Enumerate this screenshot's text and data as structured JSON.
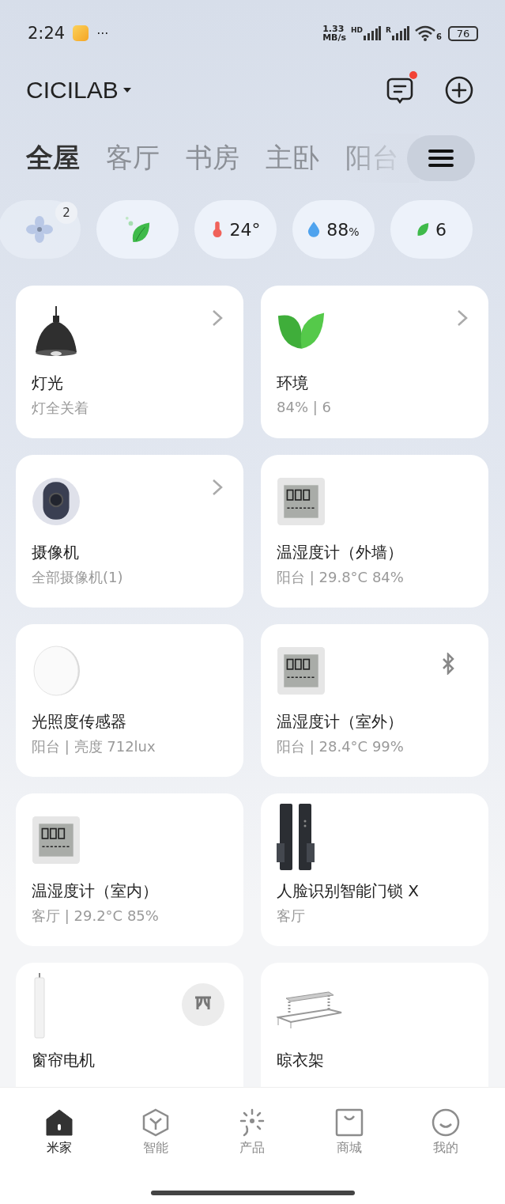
{
  "status_bar": {
    "time": "2:24",
    "more": "···",
    "speed_value": "1.33",
    "speed_unit": "MB/s",
    "sim1": "HD",
    "sim2": "R",
    "wifi": "6",
    "battery": "76"
  },
  "header": {
    "home_name": "CICILAB",
    "unread": true
  },
  "tabs": [
    {
      "label": "全屋",
      "selected": true
    },
    {
      "label": "客厅",
      "selected": false
    },
    {
      "label": "书房",
      "selected": false
    },
    {
      "label": "主卧",
      "selected": false
    },
    {
      "label": "阳台",
      "selected": false
    }
  ],
  "chips": [
    {
      "kind": "fan",
      "badge": "2"
    },
    {
      "kind": "leaf_plant"
    },
    {
      "kind": "temperature",
      "value": "24°"
    },
    {
      "kind": "humidity",
      "value": "88",
      "unit": "%"
    },
    {
      "kind": "leaf",
      "value": "6"
    }
  ],
  "devices": [
    {
      "kind": "lamp",
      "name": "灯光",
      "status": "灯全关着",
      "chevron": true
    },
    {
      "kind": "plant",
      "name": "环境",
      "status": "84% | 6",
      "chevron": true
    },
    {
      "kind": "camera",
      "name": "摄像机",
      "status": "全部摄像机(1)",
      "chevron": true
    },
    {
      "kind": "thermometer",
      "name": "温湿度计（外墙）",
      "status": "阳台 | 29.8°C 84%",
      "chevron": false
    },
    {
      "kind": "light_sensor",
      "name": "光照度传感器",
      "status": "阳台 | 亮度 712lux",
      "chevron": false
    },
    {
      "kind": "thermometer",
      "name": "温湿度计（室外）",
      "status": "阳台 | 28.4°C 99%",
      "chevron": false,
      "badge": {
        "kind": "bluetooth"
      }
    },
    {
      "kind": "thermometer",
      "name": "温湿度计（室内）",
      "status": "客厅 | 29.2°C 85%",
      "chevron": false
    },
    {
      "kind": "door_lock",
      "name": "人脸识别智能门锁 X",
      "status": "客厅",
      "chevron": false
    },
    {
      "kind": "curtain_motor",
      "name": "窗帘电机",
      "chevron": false,
      "badge": {
        "kind": "curtain"
      }
    },
    {
      "kind": "drying_rack",
      "name": "晾衣架",
      "chevron": false
    }
  ],
  "nav": [
    {
      "kind": "home",
      "label": "米家",
      "selected": true
    },
    {
      "kind": "smart",
      "label": "智能",
      "selected": false
    },
    {
      "kind": "product",
      "label": "产品",
      "selected": false
    },
    {
      "kind": "shop",
      "label": "商城",
      "selected": false
    },
    {
      "kind": "profile",
      "label": "我的",
      "selected": false
    }
  ]
}
